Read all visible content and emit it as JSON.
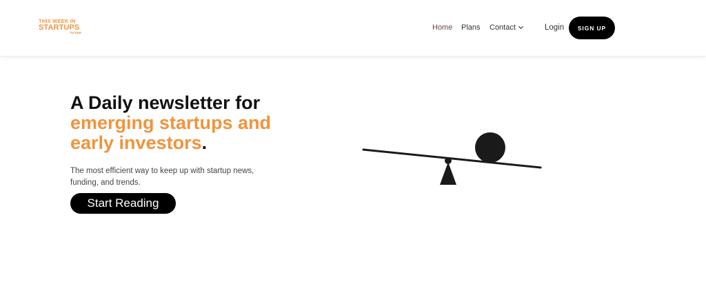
{
  "logo": {
    "line1": "THIS WEEK IN",
    "line2": "STARTUPS",
    "line3": "TICKER",
    "color": "#f0943c"
  },
  "nav": {
    "home": "Home",
    "plans": "Plans",
    "contact": "Contact",
    "login": "Login",
    "signup": "SIGN UP"
  },
  "hero": {
    "title_line1": "A Daily newsletter for",
    "title_accent": "emerging startups and early investors",
    "title_end": ".",
    "subtitle": "The most efficient way to keep up with startup news, funding, and trends.",
    "cta": "Start Reading"
  },
  "colors": {
    "accent": "#f0943c",
    "dark": "#000000",
    "background": "#ffffff"
  },
  "illustration": {
    "name": "seesaw-balance-icon"
  }
}
